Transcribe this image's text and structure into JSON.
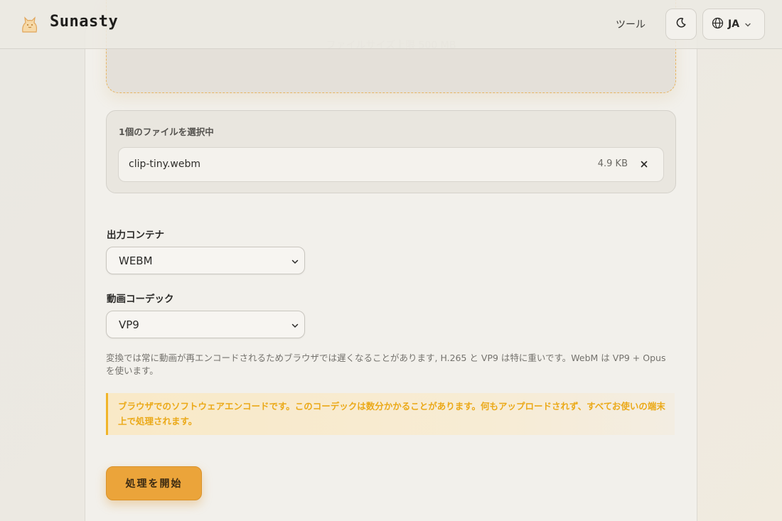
{
  "header": {
    "brand": "Sunasty",
    "nav_tools": "ツール",
    "language": "JA"
  },
  "dropzone": {
    "hint": "ファイルサイズ上限 500 MB"
  },
  "files": {
    "title": "1個のファイルを選択中",
    "items": [
      {
        "name": "clip-tiny.webm",
        "size": "4.9 KB"
      }
    ]
  },
  "form": {
    "container_label": "出力コンテナ",
    "container_value": "WEBM",
    "codec_label": "動画コーデック",
    "codec_value": "VP9",
    "help_text": "変換では常に動画が再エンコードされるためブラウザでは遅くなることがあります, H.265 と VP9 は特に重いです。WebM は VP9 + Opus を使います。",
    "notice": "ブラウザでのソフトウェアエンコードです。このコーデックは数分かかることがあります。何もアップロードされず、すべてお使いの端末上で処理されます。",
    "start_button": "処理を開始"
  },
  "colors": {
    "accent": "#eba43a",
    "notice_text": "#eba918",
    "notice_border": "#f0b429",
    "background": "#eae8e2"
  },
  "icons": {
    "logo": "cat-logo-icon",
    "theme": "moon-icon",
    "language": "globe-icon",
    "chevron": "chevron-down-icon",
    "remove": "close-icon"
  }
}
